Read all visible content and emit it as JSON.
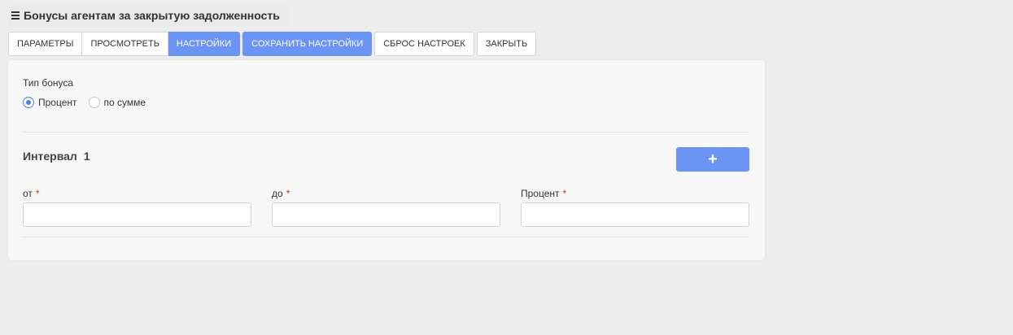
{
  "header": {
    "title": "Бонусы агентам за закрытую задолженность",
    "menu_icon": "menu-icon"
  },
  "toolbar": {
    "buttons": [
      {
        "label": "ПАРАМЕТРЫ",
        "active": false
      },
      {
        "label": "ПРОСМОТРЕТЬ",
        "active": false
      },
      {
        "label": "НАСТРОЙКИ",
        "active": true
      },
      {
        "label": "СОХРАНИТЬ НАСТРОЙКИ",
        "primary": true
      },
      {
        "label": "СБРОС НАСТРОЕК"
      },
      {
        "label": "ЗАКРЫТЬ"
      }
    ]
  },
  "bonus_type": {
    "label": "Тип бонуса",
    "options": [
      {
        "label": "Процент",
        "checked": true
      },
      {
        "label": "по сумме",
        "checked": false
      }
    ]
  },
  "interval": {
    "title": "Интервал",
    "number": "1",
    "add_button_label": "+",
    "fields": [
      {
        "label": "от",
        "required_mark": "*",
        "value": ""
      },
      {
        "label": "до",
        "required_mark": "*",
        "value": ""
      },
      {
        "label": "Процент",
        "required_mark": "*",
        "value": ""
      }
    ]
  },
  "colors": {
    "accent": "#6b94f5",
    "required": "#e0281c",
    "radio": "#4f7fd9"
  }
}
